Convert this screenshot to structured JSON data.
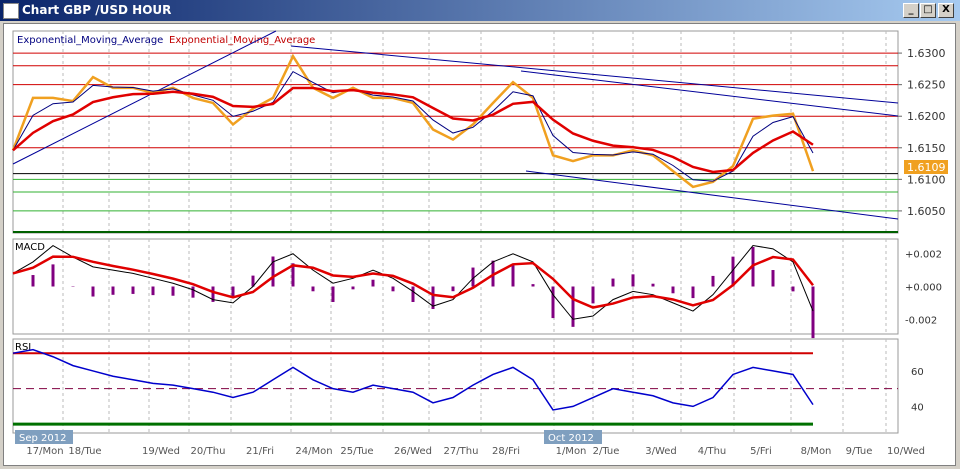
{
  "window": {
    "title": "Chart GBP /USD  HOUR",
    "buttons": {
      "minimize": "_",
      "maximize": "□",
      "close": "X"
    }
  },
  "legend": {
    "ema_fast": "Exponential_Moving_Average",
    "ema_slow": "Exponential_Moving_Average"
  },
  "colors": {
    "price": "#f0a020",
    "ema_fast": "#000080",
    "ema_slow": "#e00000",
    "trend": "#000099",
    "macd_hist": "#800080",
    "rsi": "#0000cc",
    "current_price_bg": "#f0a020"
  },
  "panes": {
    "macd_label": "MACD",
    "rsi_label": "RSI"
  },
  "current_price": "1.6109",
  "axis": {
    "price_ticks": [
      "1.6300",
      "1.6250",
      "1.6200",
      "1.6150",
      "1.6100",
      "1.6050"
    ],
    "macd_ticks": [
      "+0.002",
      "+0.000",
      "-0.002"
    ],
    "rsi_ticks": [
      "60",
      "40"
    ],
    "months": [
      "Sep 2012",
      "Oct 2012"
    ],
    "dates": [
      "17/Mon",
      "18/Tue",
      "19/Wed",
      "20/Thu",
      "21/Fri",
      "24/Mon",
      "25/Tue",
      "26/Wed",
      "27/Thu",
      "28/Fri",
      "1/Mon",
      "2/Tue",
      "3/Wed",
      "4/Thu",
      "5/Fri",
      "8/Mon",
      "9/Tue",
      "10/Wed"
    ]
  },
  "chart_data": {
    "type": "line",
    "price": [
      1.6146,
      1.6229,
      1.6229,
      1.6224,
      1.6262,
      1.6245,
      1.6245,
      1.6237,
      1.6245,
      1.6229,
      1.6221,
      1.6187,
      1.6212,
      1.6229,
      1.6295,
      1.6245,
      1.6229,
      1.6245,
      1.6229,
      1.6229,
      1.6221,
      1.6179,
      1.6163,
      1.6187,
      1.6221,
      1.6254,
      1.6229,
      1.6138,
      1.6129,
      1.6138,
      1.6138,
      1.6146,
      1.6138,
      1.6113,
      1.6088,
      1.6096,
      1.6121,
      1.6196,
      1.6201,
      1.6204,
      1.6113
    ],
    "macd": [
      0.0008,
      0.0015,
      0.0025,
      0.0018,
      0.0012,
      0.001,
      0.0008,
      0.0005,
      0.0002,
      -0.0002,
      -0.0008,
      -0.001,
      0,
      0.0015,
      0.002,
      0.001,
      0.0002,
      0.0005,
      0.001,
      0.0005,
      -0.0003,
      -0.0012,
      -0.0008,
      0.0005,
      0.0015,
      0.002,
      0.0015,
      -0.0005,
      -0.002,
      -0.0018,
      -0.0008,
      -0.0003,
      -0.0005,
      -0.001,
      -0.0015,
      -0.0005,
      0.001,
      0.0025,
      0.0023,
      0.0015,
      -0.0015
    ],
    "rsi": [
      70,
      72,
      68,
      63,
      60,
      57,
      55,
      53,
      52,
      50,
      48,
      45,
      48,
      55,
      62,
      55,
      50,
      48,
      52,
      50,
      48,
      42,
      45,
      52,
      58,
      62,
      55,
      38,
      40,
      45,
      50,
      48,
      46,
      42,
      40,
      45,
      58,
      62,
      60,
      58,
      41
    ],
    "price_levels_red": [
      1.63,
      1.628,
      1.625,
      1.62,
      1.615
    ],
    "price_levels_green": [
      1.61,
      1.608,
      1.605
    ],
    "rsi_levels": [
      70,
      50,
      30
    ],
    "ylim_price": [
      1.6015,
      1.6335
    ],
    "ylim_macd": [
      -0.0029,
      0.0029
    ],
    "ylim_rsi": [
      25,
      78
    ]
  }
}
